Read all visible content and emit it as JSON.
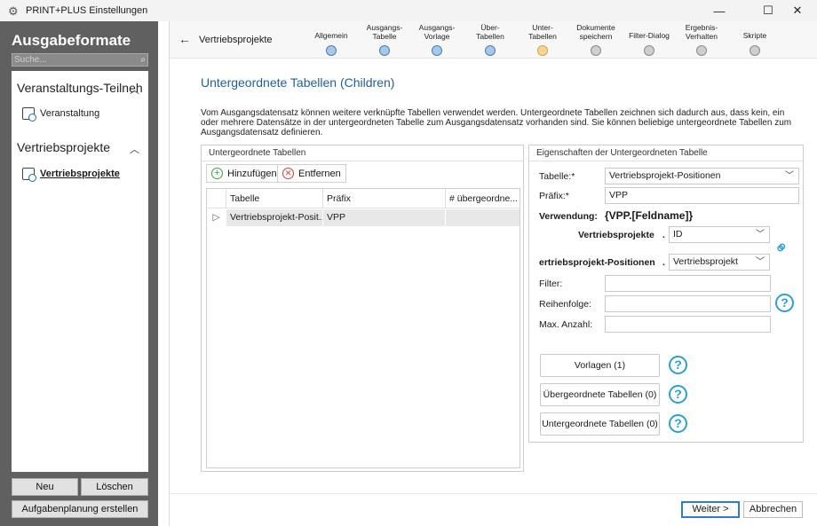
{
  "window": {
    "title": "PRINT+PLUS Einstellungen",
    "minimize": "—",
    "maximize": "☐",
    "close": "✕"
  },
  "sidebar": {
    "heading": "Ausgabeformate",
    "search_placeholder": "Suche...",
    "groups": [
      {
        "label": "Veranstaltungs-Teilneh",
        "items": [
          {
            "label": "Veranstaltung"
          }
        ]
      },
      {
        "label": "Vertriebsprojekte",
        "items": [
          {
            "label": "Vertriebsprojekte"
          }
        ]
      }
    ],
    "buttons": {
      "new": "Neu",
      "delete": "Löschen",
      "schedule": "Aufgabenplanung erstellen"
    }
  },
  "wizard": {
    "back_icon": "arrow-left-icon",
    "title": "Vertriebsprojekte",
    "steps": [
      {
        "label": "Allgemein",
        "state": "done"
      },
      {
        "label": "Ausgangs-\nTabelle",
        "state": "done"
      },
      {
        "label": "Ausgangs-\nVorlage",
        "state": "done"
      },
      {
        "label": "Über-\nTabellen",
        "state": "done"
      },
      {
        "label": "Unter-\nTabellen",
        "state": "current"
      },
      {
        "label": "Dokumente\nspeichern",
        "state": "todo"
      },
      {
        "label": "Filter-Dialog",
        "state": "todo"
      },
      {
        "label": "Ergebnis-\nVerhalten",
        "state": "todo"
      },
      {
        "label": "Skripte",
        "state": "todo"
      }
    ]
  },
  "page": {
    "title": "Untergeordnete Tabellen (Children)",
    "description": "Vom Ausgangsdatensatz können weitere verknüpfte Tabellen verwendet werden. Untergeordnete Tabellen zeichnen sich dadurch aus, dass kein, ein oder mehrere Datensätze in der untergeordneten Tabelle zum Ausgangsdatensatz vorhanden sind. Sie können beliebige untergeordnete Tabellen zum Ausgangsdatensatz definieren."
  },
  "children_panel": {
    "title": "Untergeordnete Tabellen",
    "add_label": "Hinzufügen",
    "remove_label": "Entfernen",
    "columns": [
      "Tabelle",
      "Präfix",
      "# übergeordne..."
    ],
    "rows": [
      {
        "tabelle": "Vertriebsprojekt-Posit...",
        "praefix": "VPP",
        "count": ""
      }
    ]
  },
  "props": {
    "title": "Eigenschaften der Untergeordneten Tabelle",
    "table_label": "Tabelle:*",
    "table_value": "Vertriebsprojekt-Positionen",
    "prefix_label": "Präfix:*",
    "prefix_value": "VPP",
    "usage_label": "Verwendung:",
    "usage_value": "{VPP.[Feldname]}",
    "parent_label": "Vertriebsprojekte",
    "parent_field": "ID",
    "child_label": "ertriebsprojekt-Positionen",
    "child_field": "Vertriebsprojekt",
    "dot": ".",
    "filter_label": "Filter:",
    "filter_value": "",
    "order_label": "Reihenfolge:",
    "order_value": "",
    "max_label": "Max. Anzahl:",
    "max_value": "",
    "templates_btn": "Vorlagen (1)",
    "parents_btn": "Übergeordnete Tabellen (0)",
    "children_btn": "Untergeordnete Tabellen (0)",
    "help_glyph": "?"
  },
  "footer": {
    "next": "Weiter >",
    "cancel": "Abbrechen"
  },
  "colors": {
    "accent": "#1f5f9e",
    "help": "#2a9fd8",
    "sidebar": "#606060"
  }
}
